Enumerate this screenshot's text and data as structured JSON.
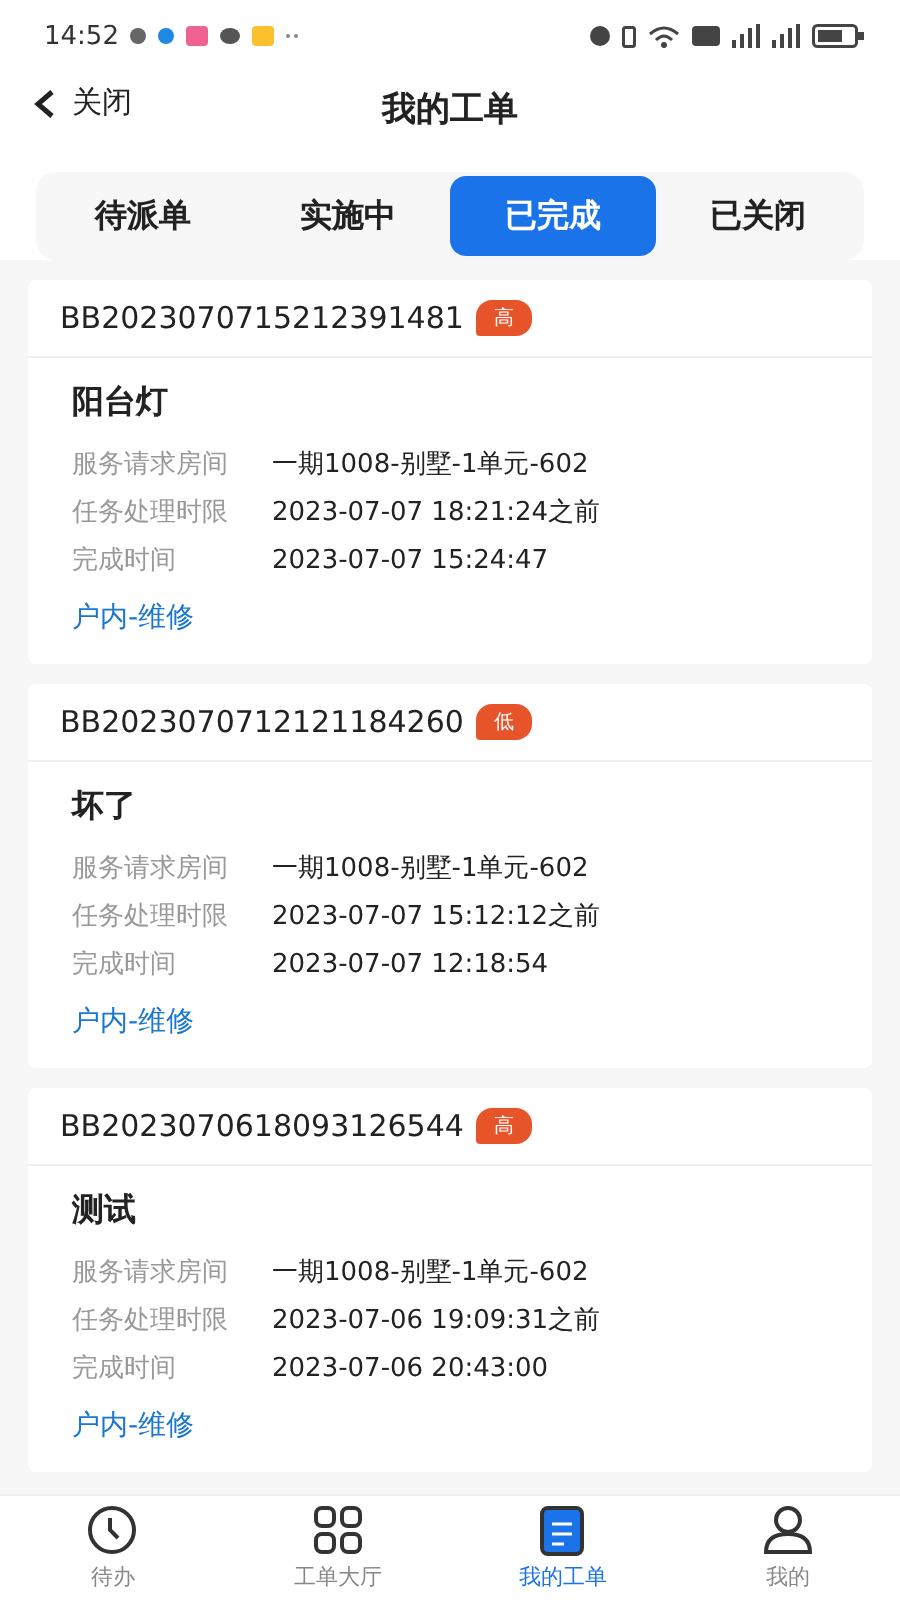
{
  "status_bar": {
    "time": "14:52"
  },
  "header": {
    "back_label": "关闭",
    "title": "我的工单"
  },
  "tabs": [
    {
      "label": "待派单",
      "selected": false
    },
    {
      "label": "实施中",
      "selected": false
    },
    {
      "label": "已完成",
      "selected": true
    },
    {
      "label": "已关闭",
      "selected": false
    }
  ],
  "orders": [
    {
      "id": "BB2023070715212391481",
      "priority": "高",
      "title": "阳台灯",
      "fields": [
        {
          "label": "服务请求房间",
          "value": "一期1008-别墅-1单元-602"
        },
        {
          "label": "任务处理时限",
          "value": "2023-07-07 18:21:24之前"
        },
        {
          "label": "完成时间",
          "value": "2023-07-07 15:24:47"
        }
      ],
      "category": "户内-维修"
    },
    {
      "id": "BB2023070712121184260",
      "priority": "低",
      "title": "坏了",
      "fields": [
        {
          "label": "服务请求房间",
          "value": "一期1008-别墅-1单元-602"
        },
        {
          "label": "任务处理时限",
          "value": "2023-07-07 15:12:12之前"
        },
        {
          "label": "完成时间",
          "value": "2023-07-07 12:18:54"
        }
      ],
      "category": "户内-维修"
    },
    {
      "id": "BB2023070618093126544",
      "priority": "高",
      "title": "测试",
      "fields": [
        {
          "label": "服务请求房间",
          "value": "一期1008-别墅-1单元-602"
        },
        {
          "label": "任务处理时限",
          "value": "2023-07-06 19:09:31之前"
        },
        {
          "label": "完成时间",
          "value": "2023-07-06 20:43:00"
        }
      ],
      "category": "户内-维修"
    }
  ],
  "bottom_nav": [
    {
      "label": "待办",
      "selected": false
    },
    {
      "label": "工单大厅",
      "selected": false
    },
    {
      "label": "我的工单",
      "selected": true
    },
    {
      "label": "我的",
      "selected": false
    }
  ]
}
